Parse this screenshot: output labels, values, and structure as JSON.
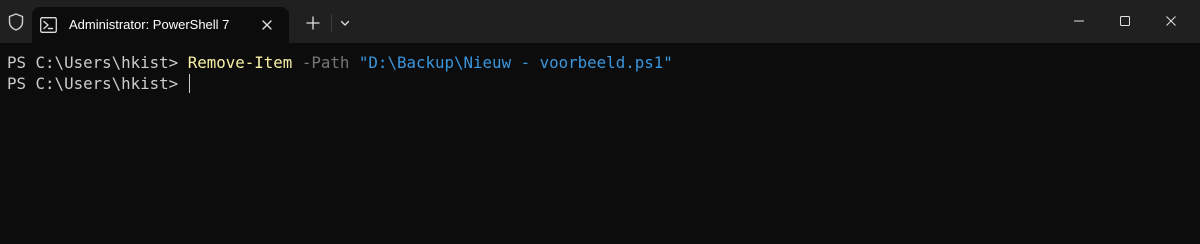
{
  "tab": {
    "title": "Administrator: PowerShell 7",
    "icon": "powershell-icon"
  },
  "titlebar": {
    "icons": [
      "shield-icon",
      "close-icon",
      "plus-icon",
      "chevron-down-icon",
      "minimize-icon",
      "maximize-icon",
      "close-icon"
    ]
  },
  "terminal": {
    "lines": [
      {
        "prompt": "PS C:\\Users\\hkist> ",
        "cmdlet": "Remove-Item",
        "param": " -Path ",
        "string": "\"D:\\Backup\\Nieuw - voorbeeld.ps1\""
      },
      {
        "prompt": "PS C:\\Users\\hkist> "
      }
    ]
  },
  "colors": {
    "background": "#0c0c0c",
    "titlebar": "#202020",
    "prompt": "#cccccc",
    "cmdlet": "#f9f1a5",
    "param": "#767676",
    "string": "#3a96dd"
  }
}
